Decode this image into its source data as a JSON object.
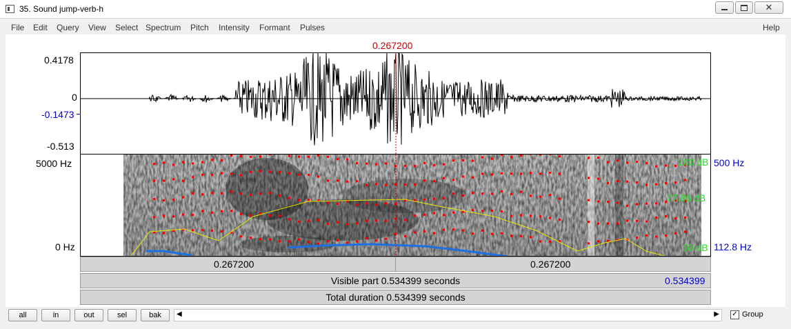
{
  "window": {
    "title": "35. Sound jump-verb-h"
  },
  "menu": [
    "File",
    "Edit",
    "Query",
    "View",
    "Select",
    "Spectrum",
    "Pitch",
    "Intensity",
    "Formant",
    "Pulses"
  ],
  "help_label": "Help",
  "cursor_time": "0.267200",
  "waveform": {
    "ymax": "0.4178",
    "zero": "0",
    "cursor_value": "-0.1473",
    "ymin": "-0.513"
  },
  "spectrogram": {
    "fmax": "5000 Hz",
    "fmin": "0 Hz",
    "db_top": "100 dB",
    "db_mid": "77.86 dB",
    "db_bottom": "50 dB",
    "pitch_top": "500 Hz",
    "pitch_cursor": "112.8 Hz"
  },
  "selection_bar": {
    "left": "0.267200",
    "right": "0.267200"
  },
  "visible_bar": {
    "start": "0",
    "label": "Visible part 0.534399 seconds",
    "end": "0.534399"
  },
  "total_bar": {
    "label": "Total duration 0.534399 seconds"
  },
  "buttons": {
    "all": "all",
    "in": "in",
    "out": "out",
    "sel": "sel",
    "bak": "bak"
  },
  "group_label": "Group",
  "colors": {
    "cursor": "#cc0000",
    "blue_text": "#0000cc",
    "green_text": "#22dd22",
    "intensity": "#e8e800",
    "pitch": "#1e6fe0",
    "formant": "#ee0000"
  }
}
